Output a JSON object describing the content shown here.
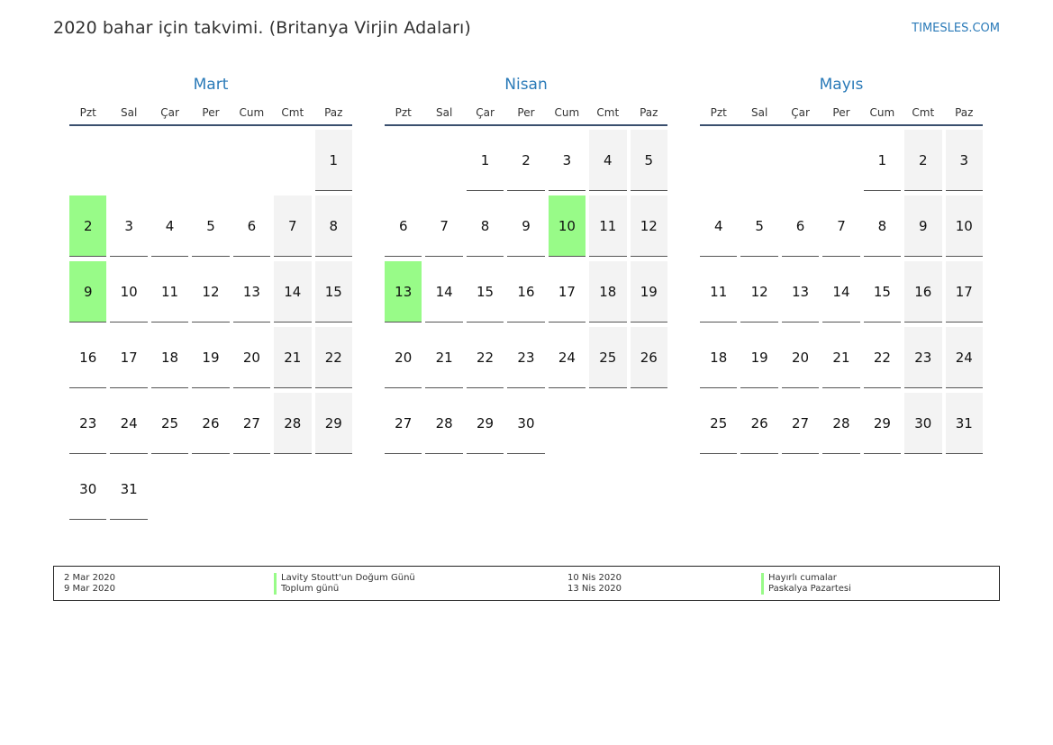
{
  "header": {
    "title": "2020 bahar için takvimi. (Britanya Virjin Adaları)",
    "site": "TIMESLES.COM"
  },
  "colors": {
    "accent": "#2a7ab8",
    "holiday": "#98fb88",
    "weekend": "#f3f3f3"
  },
  "weekdays": [
    "Pzt",
    "Sal",
    "Çar",
    "Per",
    "Cum",
    "Cmt",
    "Paz"
  ],
  "months": [
    {
      "name": "Mart",
      "weeks": [
        [
          "",
          "",
          "",
          "",
          "",
          "",
          "1"
        ],
        [
          "2",
          "3",
          "4",
          "5",
          "6",
          "7",
          "8"
        ],
        [
          "9",
          "10",
          "11",
          "12",
          "13",
          "14",
          "15"
        ],
        [
          "16",
          "17",
          "18",
          "19",
          "20",
          "21",
          "22"
        ],
        [
          "23",
          "24",
          "25",
          "26",
          "27",
          "28",
          "29"
        ],
        [
          "30",
          "31",
          "",
          "",
          "",
          "",
          ""
        ]
      ],
      "holidays": [
        "2",
        "9"
      ]
    },
    {
      "name": "Nisan",
      "weeks": [
        [
          "",
          "",
          "1",
          "2",
          "3",
          "4",
          "5"
        ],
        [
          "6",
          "7",
          "8",
          "9",
          "10",
          "11",
          "12"
        ],
        [
          "13",
          "14",
          "15",
          "16",
          "17",
          "18",
          "19"
        ],
        [
          "20",
          "21",
          "22",
          "23",
          "24",
          "25",
          "26"
        ],
        [
          "27",
          "28",
          "29",
          "30",
          "",
          "",
          ""
        ]
      ],
      "holidays": [
        "10",
        "13"
      ]
    },
    {
      "name": "Mayıs",
      "weeks": [
        [
          "",
          "",
          "",
          "",
          "1",
          "2",
          "3"
        ],
        [
          "4",
          "5",
          "6",
          "7",
          "8",
          "9",
          "10"
        ],
        [
          "11",
          "12",
          "13",
          "14",
          "15",
          "16",
          "17"
        ],
        [
          "18",
          "19",
          "20",
          "21",
          "22",
          "23",
          "24"
        ],
        [
          "25",
          "26",
          "27",
          "28",
          "29",
          "30",
          "31"
        ]
      ],
      "holidays": []
    }
  ],
  "legend": {
    "col1_dates": [
      "2 Mar 2020",
      "9 Mar 2020"
    ],
    "col1_names": [
      "Lavity Stoutt'un Doğum Günü",
      "Toplum günü"
    ],
    "col2_dates": [
      "10 Nis 2020",
      "13 Nis 2020"
    ],
    "col2_names": [
      "Hayırlı cumalar",
      "Paskalya Pazartesi"
    ]
  }
}
